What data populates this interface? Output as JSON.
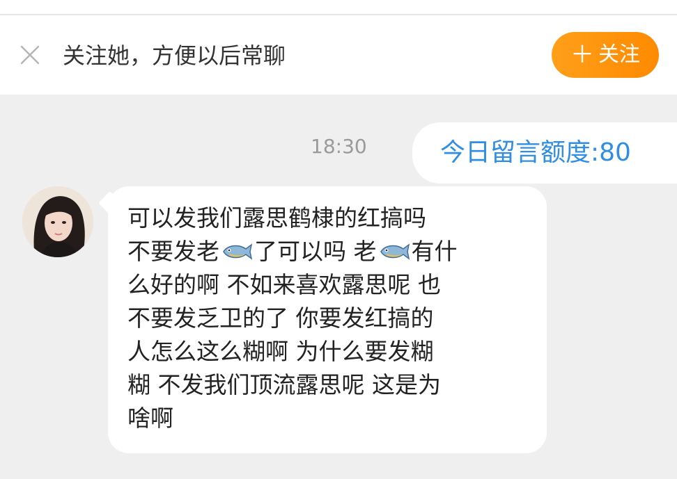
{
  "follow_bar": {
    "text": "关注她，方便以后常聊",
    "close_icon": "close-icon",
    "follow_button": {
      "icon": "plus-icon",
      "plus_symbol": "＋",
      "label": "关注",
      "color": "#ff9200"
    }
  },
  "chat": {
    "timestamp": "18:30",
    "quota_message": {
      "text": "今日留言额度:80",
      "color": "#2f8ee3"
    },
    "incoming_message": {
      "avatar": "avatar-icon",
      "lines": [
        [
          "可以发我们露思鹤棣的红搞吗"
        ],
        [
          "不要发老",
          "fish-icon",
          "了可以吗 老",
          "fish-icon",
          "有什"
        ],
        [
          "么好的啊 不如来喜欢露思呢 也"
        ],
        [
          "不要发乏卫的了 你要发红搞的"
        ],
        [
          "人怎么这么糊啊 为什么要发糊"
        ],
        [
          "糊 不发我们顶流露思呢 这是为"
        ],
        [
          "啥啊"
        ]
      ]
    }
  }
}
